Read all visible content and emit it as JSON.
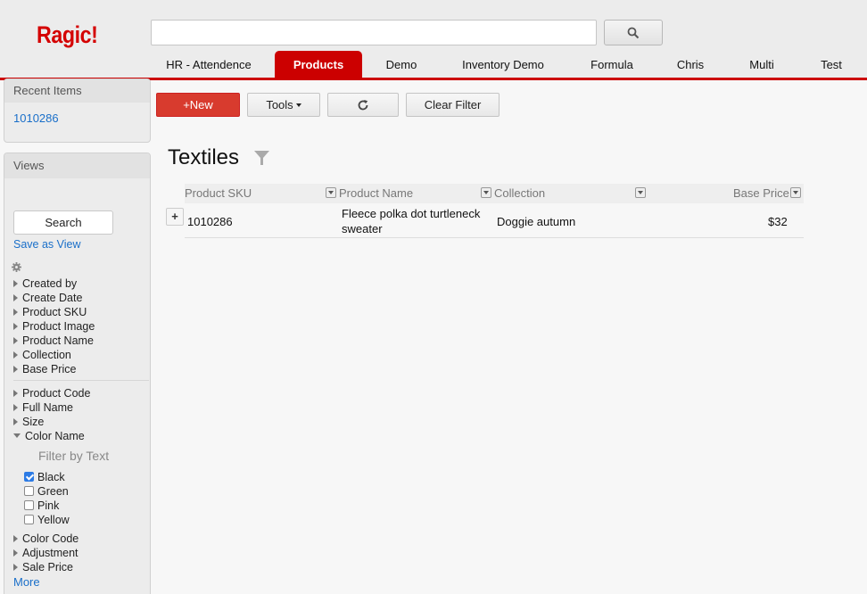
{
  "app": {
    "logo": "Ragic!"
  },
  "header": {
    "search": {
      "value": "",
      "placeholder": ""
    },
    "tabs": [
      {
        "label": "HR - Attendence"
      },
      {
        "label": "Products",
        "active": true
      },
      {
        "label": "Demo"
      },
      {
        "label": "Inventory Demo"
      },
      {
        "label": "Formula"
      },
      {
        "label": "Chris"
      },
      {
        "label": "Multi"
      },
      {
        "label": "Test"
      }
    ]
  },
  "sidebar": {
    "recent": {
      "title": "Recent Items",
      "items": [
        "1010286"
      ]
    },
    "views": {
      "title": "Views",
      "search_label": "Search",
      "save_label": "Save as View",
      "fields_group1": [
        "Created by",
        "Create Date",
        "Product SKU",
        "Product Image",
        "Product Name",
        "Collection",
        "Base Price"
      ],
      "fields_group2": [
        "Product Code",
        "Full Name",
        "Size"
      ],
      "expanded_field": "Color Name",
      "filter_by_text": "Filter by Text",
      "options": [
        {
          "label": "Black",
          "checked": true
        },
        {
          "label": "Green",
          "checked": false
        },
        {
          "label": "Pink",
          "checked": false
        },
        {
          "label": "Yellow",
          "checked": false
        }
      ],
      "fields_group3": [
        "Color Code",
        "Adjustment",
        "Sale Price"
      ],
      "more_label": "More"
    }
  },
  "toolbar": {
    "new_label": "+New",
    "tools_label": "Tools",
    "clear_filter_label": "Clear Filter"
  },
  "main": {
    "title": "Textiles",
    "columns": [
      "Product SKU",
      "Product Name",
      "Collection",
      "Base Price"
    ],
    "rows": [
      {
        "sku": "1010286",
        "name_line1": "Fleece polka dot turtleneck",
        "name_line2": "sweater",
        "collection": "Doggie autumn",
        "price": "$32"
      }
    ]
  },
  "colors": {
    "brand": "#cc0000",
    "link": "#1a6fc9",
    "new_button": "#d83b2e"
  }
}
